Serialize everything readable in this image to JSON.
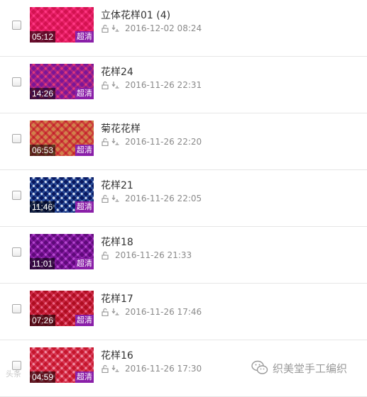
{
  "videos": [
    {
      "title": "立体花样01 (4)",
      "duration": "05:12",
      "badge": "超清",
      "date": "2016-12-02 08:24",
      "download_icon": true,
      "colors": [
        "#e8438f",
        "#ff7ab8"
      ]
    },
    {
      "title": "花样24",
      "duration": "14:26",
      "badge": "超清",
      "date": "2016-11-26 22:31",
      "download_icon": true,
      "colors": [
        "#b14ac4",
        "#f07ab0"
      ]
    },
    {
      "title": "菊花花样",
      "duration": "06:53",
      "badge": "超清",
      "date": "2016-11-26 22:20",
      "download_icon": true,
      "colors": [
        "#e7b58a",
        "#e05a6a"
      ]
    },
    {
      "title": "花样21",
      "duration": "11:46",
      "badge": "超清",
      "date": "2016-11-26 22:05",
      "download_icon": true,
      "colors": [
        "#2d4f9c",
        "#e9eef7"
      ]
    },
    {
      "title": "花样18",
      "duration": "11:01",
      "badge": "超清",
      "date": "2016-11-26 21:33",
      "download_icon": false,
      "colors": [
        "#9b2fb0",
        "#d78ae6"
      ]
    },
    {
      "title": "花样17",
      "duration": "07:26",
      "badge": "超清",
      "date": "2016-11-26 17:46",
      "download_icon": true,
      "colors": [
        "#d33a5a",
        "#f4a3b8"
      ]
    },
    {
      "title": "花样16",
      "duration": "04:59",
      "badge": "超清",
      "date": "2016-11-26 17:30",
      "download_icon": true,
      "colors": [
        "#e04a6a",
        "#f7c0cc"
      ]
    }
  ],
  "watermark": {
    "text": "织美堂手工编织",
    "icon": "wechat-icon"
  },
  "corner_watermark": "头条"
}
